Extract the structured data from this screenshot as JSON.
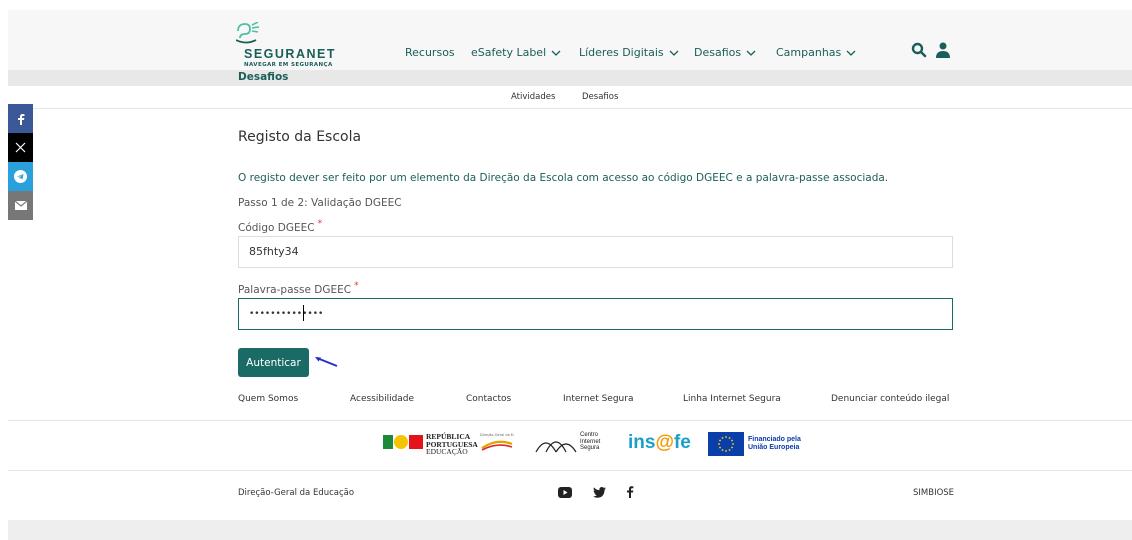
{
  "brand": {
    "name": "SEGURANET",
    "tagline": "NAVEGAR EM SEGURANÇA"
  },
  "nav": {
    "items": [
      {
        "label": "Recursos"
      },
      {
        "label": "eSafety Label"
      },
      {
        "label": "Líderes Digitais"
      },
      {
        "label": "Desafios"
      },
      {
        "label": "Campanhas"
      }
    ]
  },
  "breadcrumb": {
    "title": "Desafios"
  },
  "subnav": {
    "items": [
      "Atividades",
      "Desafios"
    ]
  },
  "form": {
    "title": "Registo da Escola",
    "info": "O registo dever ser feito por um elemento da Direção da Escola com acesso ao código DGEEC e a palavra-passe associada.",
    "step": "Passo 1 de 2: Validação DGEEC",
    "code_label": "Código DGEEC",
    "code_value": "85fhty34",
    "password_label": "Palavra-passe DGEEC",
    "password_value": "••••••••••••••",
    "required_mark": "*",
    "submit_label": "Autenticar"
  },
  "footer": {
    "links": [
      "Quem Somos",
      "Acessibilidade",
      "Contactos",
      "Internet Segura",
      "Linha Internet Segura",
      "Denunciar conteúdo ilegal"
    ],
    "logos": {
      "republica_1": "REPÚBLICA",
      "republica_2": "PORTUGUESA",
      "republica_3": "EDUCAÇÃO",
      "dge": "Direção-Geral da Educação",
      "cis_1": "Centro",
      "cis_2": "Internet",
      "cis_3": "Segura",
      "insafe_1": "ins",
      "insafe_2": "@",
      "insafe_3": "fe",
      "eu_1": "Financiado pela",
      "eu_2": "União Europeia"
    },
    "left_text": "Direção-Geral da Educação",
    "right_text": "SIMBIOSE"
  },
  "colors": {
    "brand_teal": "#1a6b66",
    "header_bg": "#f7f7f7",
    "facebook": "#3b5998",
    "x": "#000000",
    "telegram": "#2aa1dc",
    "email": "#777777"
  }
}
